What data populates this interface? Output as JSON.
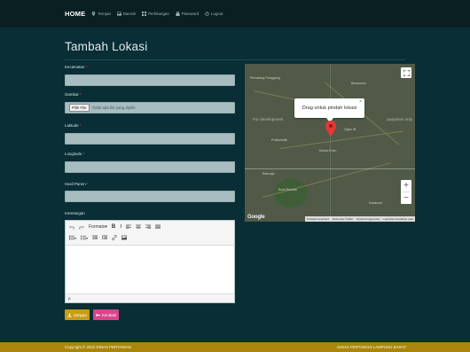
{
  "navbar": {
    "brand": "HOME",
    "items": [
      {
        "label": "Tempat",
        "icon": "map-marker-icon"
      },
      {
        "label": "Daerah",
        "icon": "image-icon"
      },
      {
        "label": "Perhitungan",
        "icon": "grid-icon"
      },
      {
        "label": "Password",
        "icon": "lock-icon"
      },
      {
        "label": "Logout",
        "icon": "power-icon"
      }
    ]
  },
  "page": {
    "title": "Tambah Lokasi"
  },
  "form": {
    "kecamatan_label": "Kecamatan",
    "gambar_label": "Gambar",
    "file_button": "Pilih File",
    "file_status": "Tidak ada file yang dipilih",
    "latitude_label": "Latitude",
    "longitude_label": "Longitude",
    "hasil_label": "Hasil Panen",
    "keterangan_label": "Keterangan",
    "required_mark": "*"
  },
  "editor": {
    "formats_label": "Formats",
    "status_path": "p"
  },
  "buttons": {
    "save": "Simpan",
    "back": "Kembali"
  },
  "map": {
    "tooltip": "Drag untuk pindah lokasi",
    "tooltip_close": "×",
    "dev_left": "For development",
    "dev_right": "purposes only",
    "places": [
      "Pematang Panggang",
      "Banyuasin",
      "Ogan Ilir",
      "Prabumulih",
      "Muara Enim",
      "Baturaja",
      "Bukit Barisan",
      "Kotabumi"
    ],
    "zoom_in": "+",
    "zoom_out": "−",
    "google": "Google",
    "attributions": [
      "Pintasan keyboard",
      "Data peta ©2022",
      "Syarat Penggunaan",
      "Laporkan kesalahan peta"
    ]
  },
  "footer": {
    "left": "Copyright © 2022 DINAS PERTANIAN",
    "right": "DINAS PERTANIAN LAMPUNG BARAT"
  },
  "colors": {
    "background": "#092e36",
    "navbar": "#0a1f22",
    "input": "#a8bdc0",
    "save_button": "#c89d14",
    "back_button": "#d9448b",
    "footer": "#a8860d",
    "required": "#e0523f",
    "pin": "#e53935"
  }
}
